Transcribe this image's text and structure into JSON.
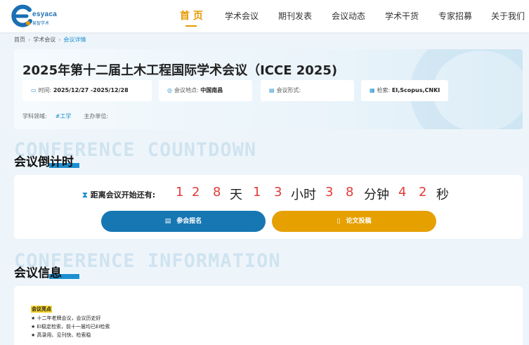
{
  "header": {
    "logo": {
      "text": "esyaca",
      "sub": "易智学术"
    },
    "nav": [
      {
        "label": "首 页",
        "active": true
      },
      {
        "label": "学术会议"
      },
      {
        "label": "期刊发表"
      },
      {
        "label": "会议动态"
      },
      {
        "label": "学术干货"
      },
      {
        "label": "专家招募"
      },
      {
        "label": "关于我们"
      }
    ]
  },
  "breadcrumb": [
    "首页",
    "学术会议",
    "会议详情"
  ],
  "conference": {
    "title": "2025年第十二届土木工程国际学术会议（ICCE 2025)",
    "time_label": "时间:",
    "time_value": "2025/12/27 -2025/12/28",
    "location_label": "会议地点:",
    "location_value": "中国南昌",
    "format_label": "会议形式:",
    "format_value": "",
    "index_label": "检索:",
    "index_value": "EI,Scopus,CNKI",
    "field_label": "学科领域:",
    "field_tag": "#工学",
    "organizer_label": "主办单位:"
  },
  "countdown": {
    "bg_text": "CONFERENCE COUNTDOWN",
    "title": "会议倒计时",
    "label": "距离会议开始还有:",
    "digits": [
      "1",
      "2",
      "8",
      "1",
      "3",
      "3",
      "8",
      "4",
      "2"
    ],
    "units": [
      "天",
      "小时",
      "分钟",
      "秒"
    ],
    "register_label": "参会报名",
    "submit_label": "论文投稿"
  },
  "info": {
    "bg_text": "CONFERENCE INFORMATION",
    "title": "会议信息",
    "highlight_title": "会议亮点",
    "highlights": [
      "★ 十二年老牌会议，会议历史好",
      "★ EI稳定检索，前十一届均已EI检索",
      "★ 高录用、见刊快、检索稳"
    ]
  },
  "colors": {
    "accent": "#e69a00",
    "primary": "#1677b3",
    "countdown_digit": "#e23b3b"
  }
}
